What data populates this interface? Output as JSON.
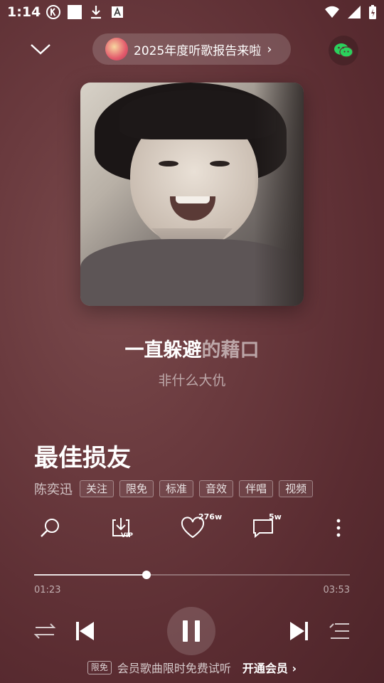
{
  "status_bar": {
    "time": "1:14",
    "icons": [
      "k-app-icon",
      "square-icon",
      "download-icon",
      "font-icon"
    ],
    "right_icons": [
      "wifi-icon",
      "signal-icon",
      "battery-charging-icon"
    ]
  },
  "header": {
    "report_label": "2025年度听歌报告来啦",
    "report_chevron": "›"
  },
  "lyrics": {
    "current_sung": "一直躲避",
    "current_unsung": "的藉口",
    "next_line": "非什么大仇"
  },
  "song": {
    "title": "最佳损友",
    "artist": "陈奕迅",
    "tags": [
      "关注",
      "限免",
      "标准",
      "音效",
      "伴唱",
      "视频"
    ]
  },
  "actions": {
    "download_sub": "VIP",
    "like_count": "276w",
    "comment_count": "5w"
  },
  "progress": {
    "current": "01:23",
    "total": "03:53",
    "fraction": 0.356
  },
  "vip_bar": {
    "tag": "限免",
    "text": "会员歌曲限时免费试听",
    "open_label": "开通会员",
    "open_chevron": "›"
  },
  "colors": {
    "background": "#6a3a3e",
    "accent": "#ffffff",
    "wechat_green": "#2bd05c"
  }
}
